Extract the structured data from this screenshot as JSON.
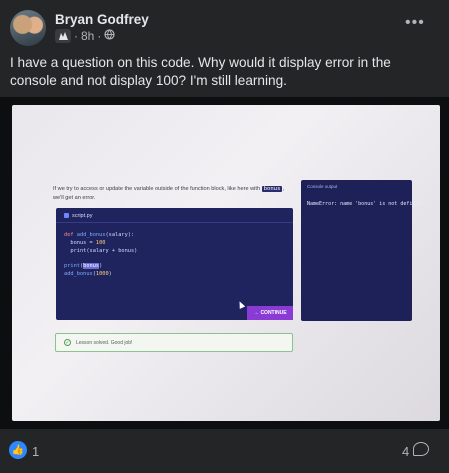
{
  "post": {
    "author": "Bryan Godfrey",
    "time": "8h",
    "separator": "·",
    "more_label": "•••",
    "text": "I have a question on this code. Why would it display error in the console and not display 100? I'm still learning."
  },
  "screenshot": {
    "lesson_text_before": "If we try to access or update the variable outside of the function block, like here with ",
    "lesson_text_code": "bonus",
    "lesson_text_after": ", we'll get an error.",
    "file_tab": "script.py",
    "code": {
      "line1_kw": "def",
      "line1_fn": "add_bonus",
      "line1_rest": "(salary):",
      "line2": "  bonus = ",
      "line2_num": "100",
      "line3": "  print(salary + bonus)",
      "line5_fn": "print",
      "line5_open": "(",
      "line5_hl": "bonus",
      "line5_close": ")",
      "line6_fn": "add_bonus",
      "line6_open": "(",
      "line6_num": "1000",
      "line6_close": ")"
    },
    "continue_label": "CONTINUE",
    "continue_arrow": "→",
    "console_title": "Console output",
    "console_output": "NameError: name 'bonus' is not defined",
    "solved_text": "Lesson solved. Good job!",
    "check_glyph": "✓"
  },
  "footer": {
    "like_count": "1",
    "comment_count": "4",
    "like_glyph": "👍"
  }
}
